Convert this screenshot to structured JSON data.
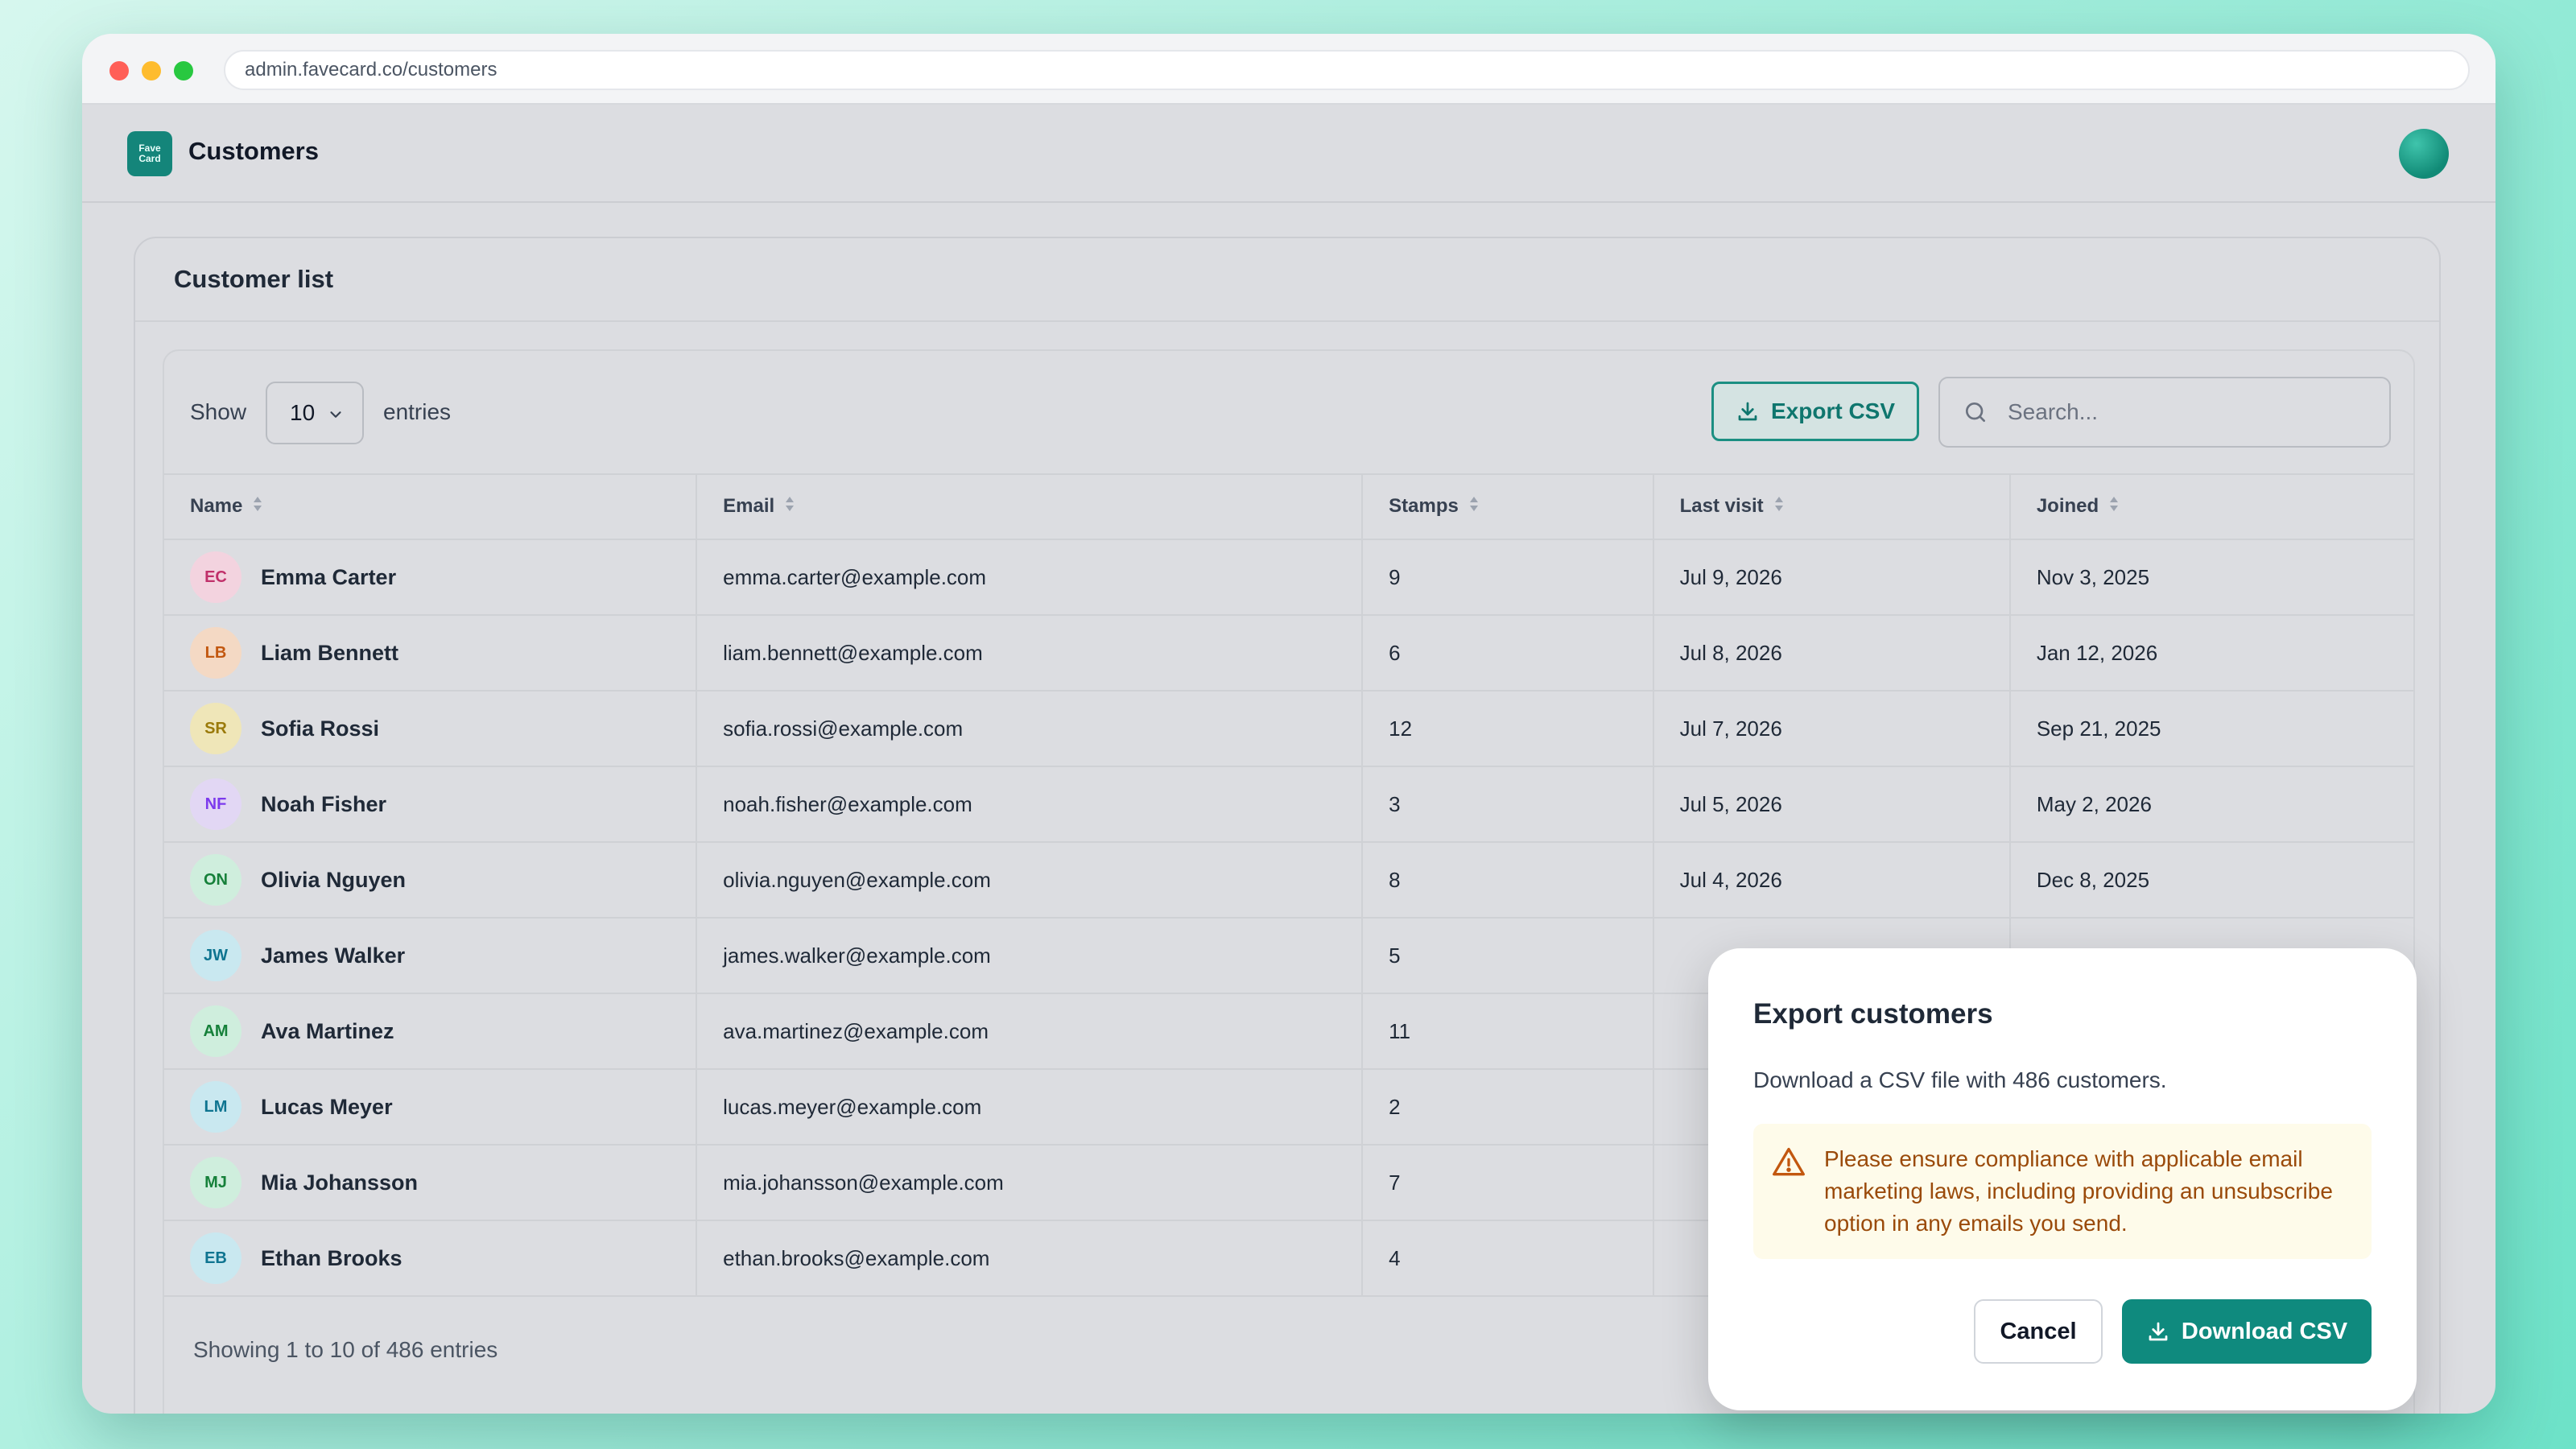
{
  "browser": {
    "url": "admin.favecard.co/customers"
  },
  "app": {
    "logo_line1": "Fave",
    "logo_line2": "Card",
    "title": "Customers"
  },
  "card": {
    "title": "Customer list"
  },
  "controls": {
    "show_label": "Show",
    "entries_value": "10",
    "entries_label": "entries",
    "export_label": "Export CSV",
    "search_placeholder": "Search..."
  },
  "table": {
    "columns": [
      "Name",
      "Email",
      "Stamps",
      "Last visit",
      "Joined"
    ],
    "rows": [
      {
        "initials": "EC",
        "name": "Emma Carter",
        "email": "emma.carter@example.com",
        "stamps": "9",
        "last_visit": "Jul 9, 2026",
        "joined": "Nov 3, 2025",
        "bg": "#f3d3df",
        "fg": "#c0306a"
      },
      {
        "initials": "LB",
        "name": "Liam Bennett",
        "email": "liam.bennett@example.com",
        "stamps": "6",
        "last_visit": "Jul 8, 2026",
        "joined": "Jan 12, 2026",
        "bg": "#f4d9c4",
        "fg": "#c2570f"
      },
      {
        "initials": "SR",
        "name": "Sofia Rossi",
        "email": "sofia.rossi@example.com",
        "stamps": "12",
        "last_visit": "Jul 7, 2026",
        "joined": "Sep 21, 2025",
        "bg": "#efe6b8",
        "fg": "#9a7a0a"
      },
      {
        "initials": "NF",
        "name": "Noah Fisher",
        "email": "noah.fisher@example.com",
        "stamps": "3",
        "last_visit": "Jul 5, 2026",
        "joined": "May 2, 2026",
        "bg": "#e2d7f4",
        "fg": "#7c3aed"
      },
      {
        "initials": "ON",
        "name": "Olivia Nguyen",
        "email": "olivia.nguyen@example.com",
        "stamps": "8",
        "last_visit": "Jul 4, 2026",
        "joined": "Dec 8, 2025",
        "bg": "#cfeedd",
        "fg": "#16803a"
      },
      {
        "initials": "JW",
        "name": "James Walker",
        "email": "james.walker@example.com",
        "stamps": "5",
        "last_visit": "",
        "joined": "",
        "bg": "#c9e8f0",
        "fg": "#0e7490"
      },
      {
        "initials": "AM",
        "name": "Ava Martinez",
        "email": "ava.martinez@example.com",
        "stamps": "11",
        "last_visit": "",
        "joined": "",
        "bg": "#cfeedd",
        "fg": "#16803a"
      },
      {
        "initials": "LM",
        "name": "Lucas Meyer",
        "email": "lucas.meyer@example.com",
        "stamps": "2",
        "last_visit": "",
        "joined": "",
        "bg": "#c9e8f0",
        "fg": "#0e7490"
      },
      {
        "initials": "MJ",
        "name": "Mia Johansson",
        "email": "mia.johansson@example.com",
        "stamps": "7",
        "last_visit": "",
        "joined": "",
        "bg": "#cfeedd",
        "fg": "#16803a"
      },
      {
        "initials": "EB",
        "name": "Ethan Brooks",
        "email": "ethan.brooks@example.com",
        "stamps": "4",
        "last_visit": "",
        "joined": "",
        "bg": "#c9e8f0",
        "fg": "#0e7490"
      }
    ],
    "footer": "Showing 1 to 10 of 486 entries"
  },
  "modal": {
    "title": "Export customers",
    "description": "Download a CSV file with 486 customers.",
    "warning": "Please ensure compliance with applicable email marketing laws, including providing an unsubscribe option in any emails you send.",
    "cancel_label": "Cancel",
    "download_label": "Download CSV"
  },
  "colors": {
    "accent": "#0f8a7e",
    "warning_text": "#9a4a0a",
    "warning_bg": "#fefbea"
  },
  "icons": [
    "download-icon",
    "search-icon",
    "chevron-down-icon",
    "sort-icon",
    "warning-icon"
  ]
}
